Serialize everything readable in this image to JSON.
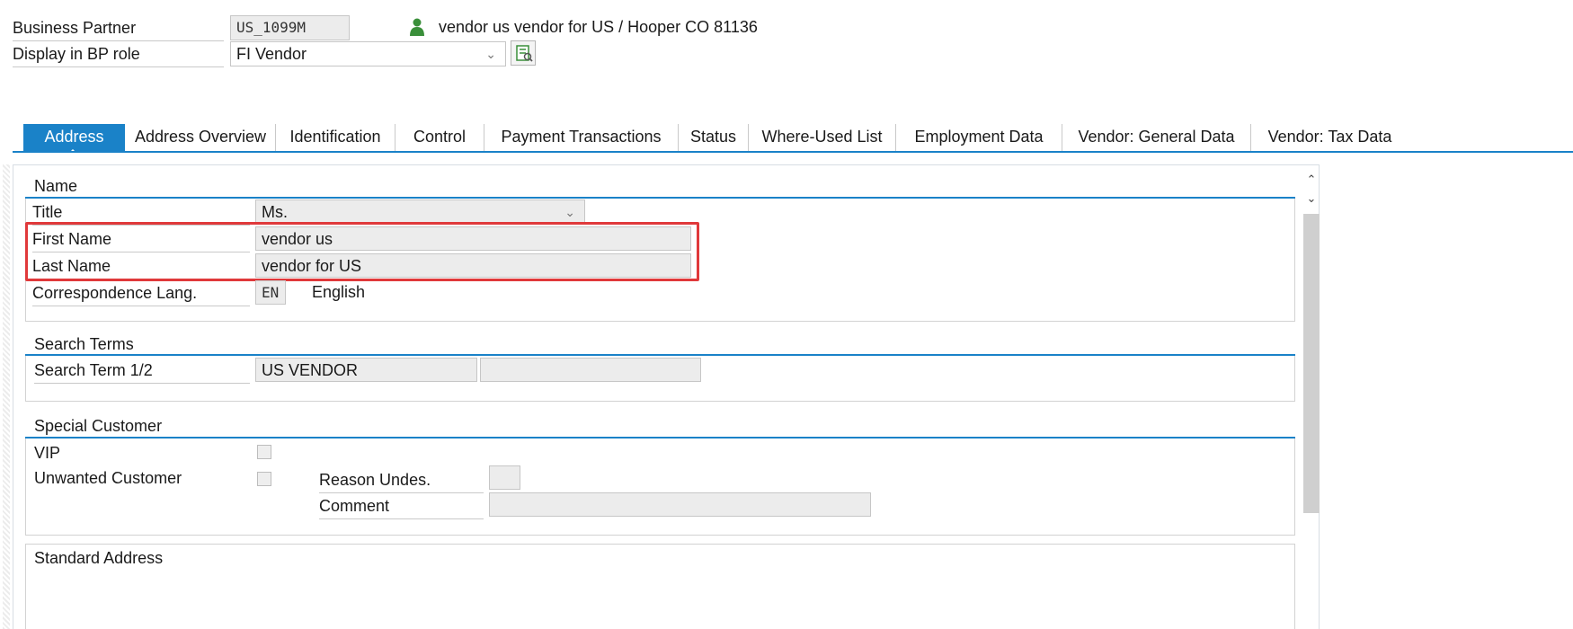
{
  "header": {
    "bp_label": "Business Partner",
    "bp_value": "US_1099M",
    "bp_description": "vendor us vendor for US / Hooper CO 81136",
    "role_label": "Display in BP role",
    "role_value": "FI Vendor"
  },
  "tabs": [
    {
      "label": "Address"
    },
    {
      "label": "Address Overview"
    },
    {
      "label": "Identification"
    },
    {
      "label": "Control"
    },
    {
      "label": "Payment Transactions"
    },
    {
      "label": "Status"
    },
    {
      "label": "Where-Used List"
    },
    {
      "label": "Employment Data"
    },
    {
      "label": "Vendor: General Data"
    },
    {
      "label": "Vendor: Tax Data"
    }
  ],
  "name_section": {
    "title": "Name",
    "title_label": "Title",
    "title_value": "Ms.",
    "first_name_label": "First Name",
    "first_name_value": "vendor us",
    "last_name_label": "Last Name",
    "last_name_value": "vendor for US",
    "lang_label": "Correspondence Lang.",
    "lang_code": "EN",
    "lang_name": "English"
  },
  "search_section": {
    "title": "Search Terms",
    "label": "Search Term 1/2",
    "term1": "US VENDOR",
    "term2": ""
  },
  "special_section": {
    "title": "Special Customer",
    "vip_label": "VIP",
    "unwanted_label": "Unwanted Customer",
    "reason_label": "Reason Undes.",
    "reason_value": "",
    "comment_label": "Comment",
    "comment_value": ""
  },
  "address_section": {
    "title": "Standard Address"
  },
  "colors": {
    "accent": "#1a82c8",
    "highlight_box": "#e0393b",
    "person_icon": "#3a8f3a"
  },
  "icons": {
    "person": "person-icon",
    "dropdown": "chevron-down-icon",
    "switch_role": "switch-role-icon",
    "scroll_up": "chevron-up-icon",
    "scroll_down": "chevron-down-icon"
  }
}
